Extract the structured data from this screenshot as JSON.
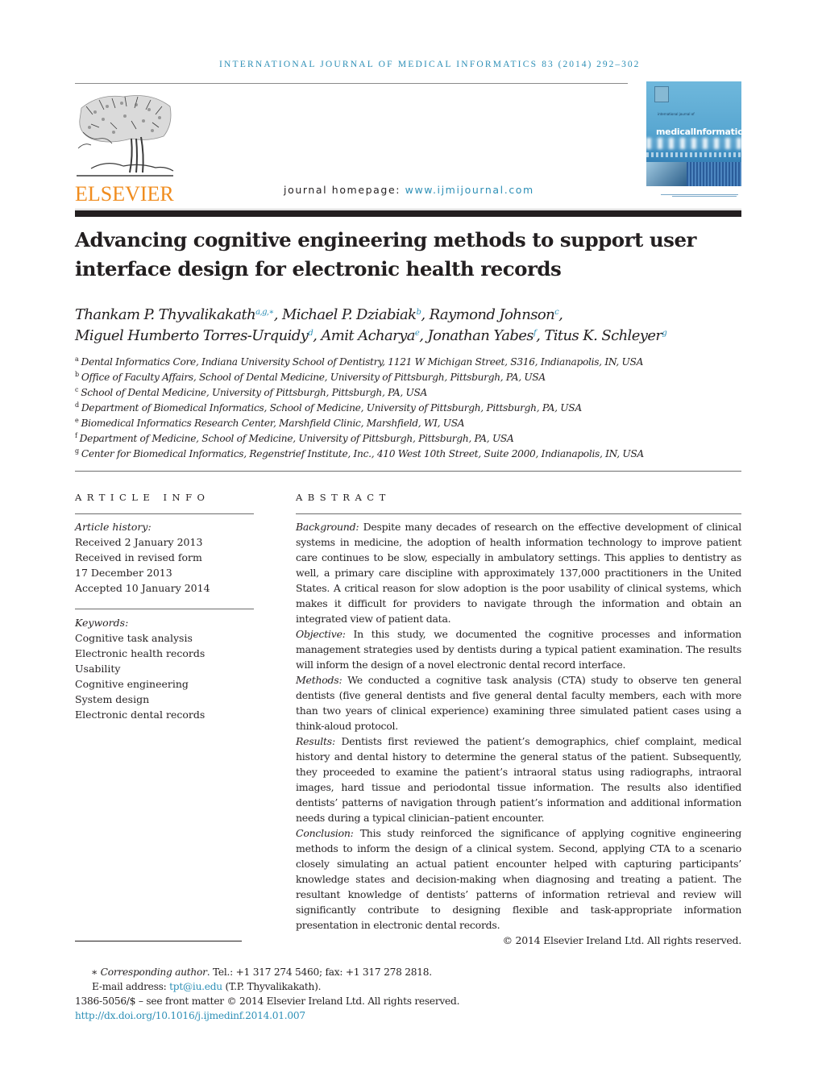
{
  "header": {
    "journal_name": "international journal of medical informatics",
    "volume_info": "83 (2014) 292–302",
    "publisher_logo_text": "ELSEVIER",
    "homepage_label": "journal homepage: ",
    "homepage_url": "www.ijmijournal.com",
    "cover_title": "medicalInformatics",
    "cover_subtitle": "international journal of"
  },
  "colors": {
    "accent_link": "#2d8fb6",
    "elsevier_orange": "#f08c1e",
    "text": "#231f20"
  },
  "article": {
    "title": "Advancing cognitive engineering methods to support user interface design for electronic health records",
    "authors": [
      {
        "name": "Thankam P. Thyvalikakath",
        "sup": "a,g,∗",
        "sep": ", "
      },
      {
        "name": "Michael P. Dziabiak",
        "sup": "b",
        "sep": ", "
      },
      {
        "name": "Raymond Johnson",
        "sup": "c",
        "sep": ","
      },
      {
        "name": "Miguel Humberto Torres-Urquidy",
        "sup": "d",
        "sep": ", "
      },
      {
        "name": "Amit Acharya",
        "sup": "e",
        "sep": ", "
      },
      {
        "name": "Jonathan Yabes",
        "sup": "f",
        "sep": ", "
      },
      {
        "name": "Titus K. Schleyer",
        "sup": "g",
        "sep": ""
      }
    ],
    "affiliations": [
      {
        "key": "a",
        "text": "Dental Informatics Core, Indiana University School of Dentistry, 1121 W Michigan Street, S316, Indianapolis, IN, USA"
      },
      {
        "key": "b",
        "text": "Office of Faculty Affairs, School of Dental Medicine, University of Pittsburgh, Pittsburgh, PA, USA"
      },
      {
        "key": "c",
        "text": "School of Dental Medicine, University of Pittsburgh, Pittsburgh, PA, USA"
      },
      {
        "key": "d",
        "text": "Department of Biomedical Informatics, School of Medicine, University of Pittsburgh, Pittsburgh, PA, USA"
      },
      {
        "key": "e",
        "text": "Biomedical Informatics Research Center, Marshfield Clinic, Marshfield, WI, USA"
      },
      {
        "key": "f",
        "text": "Department of Medicine, School of Medicine, University of Pittsburgh, Pittsburgh, PA, USA"
      },
      {
        "key": "g",
        "text": "Center for Biomedical Informatics, Regenstrief Institute, Inc., 410 West 10th Street, Suite 2000, Indianapolis, IN, USA"
      }
    ]
  },
  "article_info": {
    "heading": "ARTICLE INFO",
    "history_label": "Article history:",
    "history": [
      "Received 2 January 2013",
      "Received in revised form",
      "17 December 2013",
      "Accepted 10 January 2014"
    ],
    "keywords_label": "Keywords:",
    "keywords": [
      "Cognitive task analysis",
      "Electronic health records",
      "Usability",
      "Cognitive engineering",
      "System design",
      "Electronic dental records"
    ]
  },
  "abstract": {
    "heading": "ABSTRACT",
    "sections": [
      {
        "label": "Background:",
        "text": " Despite many decades of research on the effective development of clinical systems in medicine, the adoption of health information technology to improve patient care continues to be slow, especially in ambulatory settings. This applies to dentistry as well, a primary care discipline with approximately 137,000 practitioners in the United States. A critical reason for slow adoption is the poor usability of clinical systems, which makes it difficult for providers to navigate through the information and obtain an integrated view of patient data."
      },
      {
        "label": "Objective:",
        "text": " In this study, we documented the cognitive processes and information management strategies used by dentists during a typical patient examination. The results will inform the design of a novel electronic dental record interface."
      },
      {
        "label": "Methods:",
        "text": " We conducted a cognitive task analysis (CTA) study to observe ten general dentists (five general dentists and five general dental faculty members, each with more than two years of clinical experience) examining three simulated patient cases using a think-aloud protocol."
      },
      {
        "label": "Results:",
        "text": " Dentists first reviewed the patient’s demographics, chief complaint, medical history and dental history to determine the general status of the patient. Subsequently, they proceeded to examine the patient’s intraoral status using radiographs, intraoral images, hard tissue and periodontal tissue information. The results also identified dentists’ patterns of navigation through patient’s information and additional information needs during a typical clinician–patient encounter."
      },
      {
        "label": "Conclusion:",
        "text": " This study reinforced the significance of applying cognitive engineering methods to inform the design of a clinical system. Second, applying CTA to a scenario closely simulating an actual patient encounter helped with capturing participants’ knowledge states and decision-making when diagnosing and treating a patient. The resultant knowledge of dentists’ patterns of information retrieval and review will significantly contribute to designing flexible and task-appropriate information presentation in electronic dental records."
      }
    ],
    "copyright": "© 2014 Elsevier Ireland Ltd. All rights reserved."
  },
  "footnotes": {
    "star": "∗",
    "corresponding_label": "Corresponding author",
    "corresponding_text": ". Tel.: +1 317 274 5460; fax: +1 317 278 2818.",
    "email_label": "E-mail address: ",
    "email": "tpt@iu.edu",
    "email_suffix": " (T.P. Thyvalikakath).",
    "front_matter": "1386-5056/$ – see front matter © 2014 Elsevier Ireland Ltd. All rights reserved.",
    "doi": "http://dx.doi.org/10.1016/j.ijmedinf.2014.01.007"
  }
}
